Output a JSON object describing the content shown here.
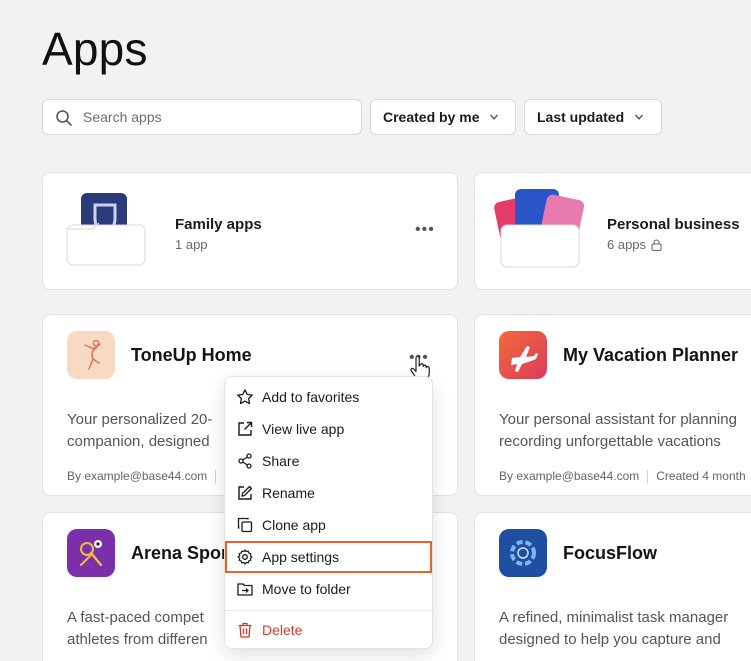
{
  "page": {
    "title": "Apps"
  },
  "search": {
    "placeholder": "Search apps",
    "icon": "search-icon"
  },
  "filters": [
    {
      "label": "Created by me",
      "icon": "chevron-down-icon"
    },
    {
      "label": "Last updated",
      "icon": "chevron-down-icon"
    }
  ],
  "folders": [
    {
      "name": "Family apps",
      "count": "1 app",
      "locked": false
    },
    {
      "name": "Personal business",
      "count": "6 apps",
      "locked": true
    }
  ],
  "apps": [
    {
      "name": "ToneUp Home",
      "description_line1": "Your personalized 20-",
      "description_line2": "companion, designed",
      "by": "By example@base44.com",
      "icon": "fitness-figure-icon"
    },
    {
      "name": "My Vacation Planner",
      "description_line1": "Your personal assistant for planning",
      "description_line2": "recording unforgettable vacations",
      "by": "By example@base44.com",
      "updated": "Created 4 month",
      "icon": "airplane-icon"
    },
    {
      "name": "Arena Spor",
      "description_line1": "A fast-paced compet",
      "description_line2": "athletes from differen",
      "icon": "sports-icon"
    },
    {
      "name": "FocusFlow",
      "description_line1": "A refined, minimalist task manager",
      "description_line2": "designed to help you capture and",
      "icon": "focus-ring-icon"
    }
  ],
  "context_menu": {
    "items": [
      {
        "label": "Add to favorites",
        "icon": "star-icon"
      },
      {
        "label": "View live app",
        "icon": "external-link-icon"
      },
      {
        "label": "Share",
        "icon": "share-icon"
      },
      {
        "label": "Rename",
        "icon": "edit-icon"
      },
      {
        "label": "Clone app",
        "icon": "copy-icon"
      },
      {
        "label": "App settings",
        "icon": "gear-icon",
        "highlighted": true
      },
      {
        "label": "Move to folder",
        "icon": "folder-move-icon"
      },
      {
        "label": "Delete",
        "icon": "trash-icon",
        "danger": true
      }
    ]
  },
  "colors": {
    "background": "#f3f2f0",
    "highlight": "#e8622c",
    "danger": "#d23a2e"
  }
}
